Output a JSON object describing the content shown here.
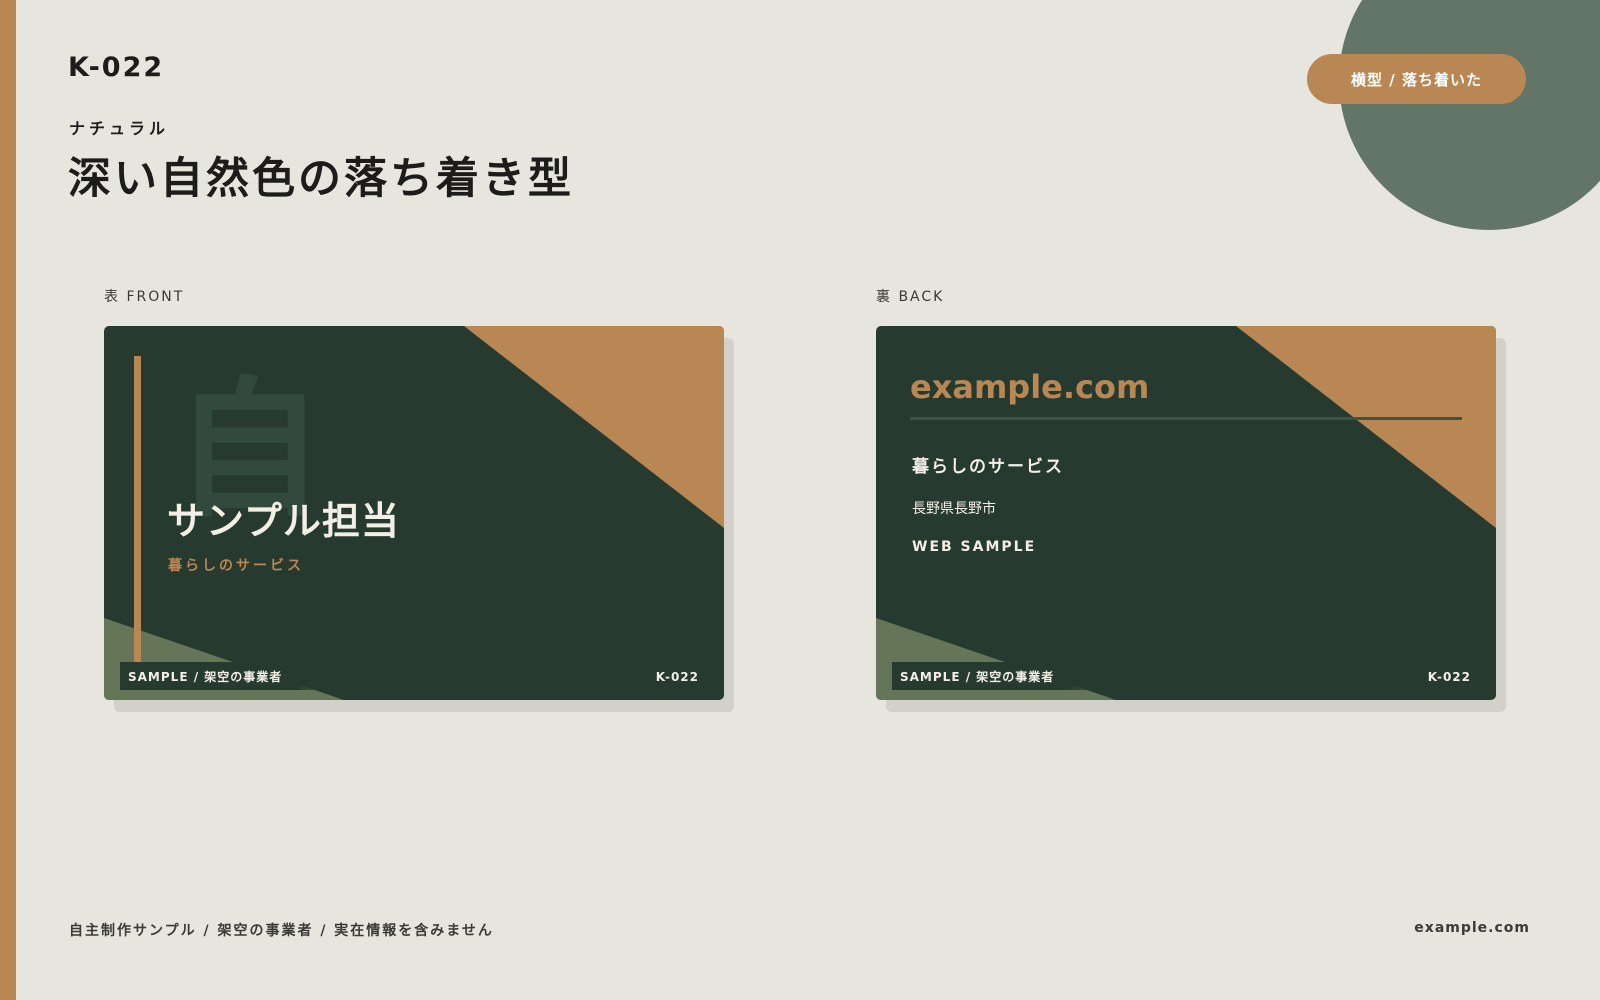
{
  "header": {
    "code": "K-022",
    "category": "ナチュラル",
    "title": "深い自然色の落ち着き型",
    "tag": "横型 / 落ち着いた"
  },
  "labels": {
    "front": "表 FRONT",
    "back": "裏 BACK"
  },
  "front_card": {
    "kanji": "自",
    "person": "サンプル担当",
    "company": "暮らしのサービス",
    "footer": "SAMPLE / 架空の事業者",
    "code": "K-022"
  },
  "back_card": {
    "url": "example.com",
    "company": "暮らしのサービス",
    "address": "長野県長野市",
    "web": "WEB SAMPLE",
    "footer": "SAMPLE / 架空の事業者",
    "code": "K-022"
  },
  "footer": {
    "disclaimer": "自主制作サンプル / 架空の事業者 / 実在情報を含みません",
    "site": "example.com"
  },
  "colors": {
    "background": "#e7e6de",
    "card": "#263a30",
    "accent": "#b98753",
    "moss": "#657658",
    "circle": "#627567"
  }
}
